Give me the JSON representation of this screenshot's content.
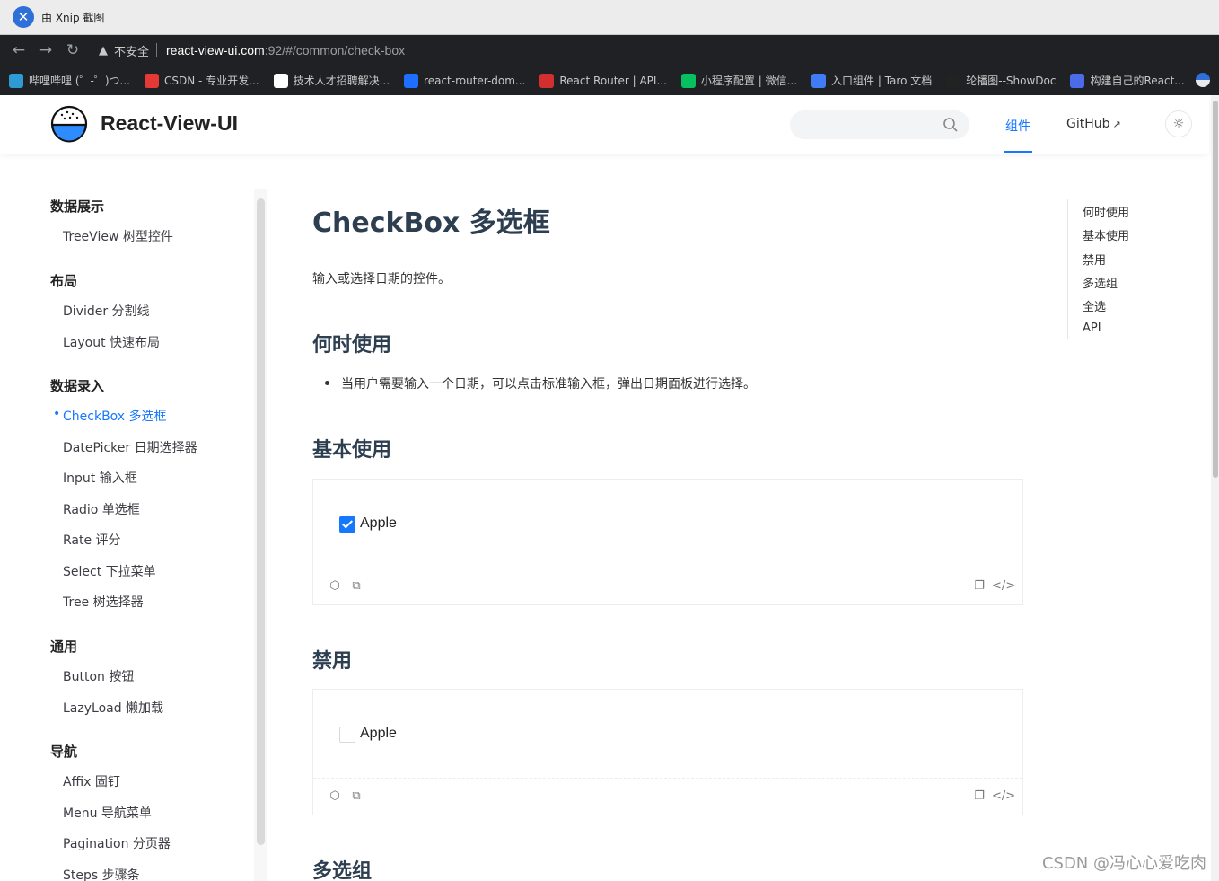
{
  "os_title": "由 Xnip 截图",
  "browser": {
    "insecure_label": "不安全",
    "url_host": "react-view-ui.com",
    "url_path": ":92/#/common/check-box",
    "bookmarks": [
      {
        "label": "哔哩哔哩 (゜-゜)つ...",
        "color": "#2f9bd6",
        "icon": "tv-icon"
      },
      {
        "label": "CSDN - 专业开发...",
        "color": "#e53935",
        "icon": "csdn-icon"
      },
      {
        "label": "技术人才招聘解决...",
        "color": "#ffffff",
        "icon": "recruit-icon"
      },
      {
        "label": "react-router-dom...",
        "color": "#1e6fff",
        "icon": "zhihu-icon"
      },
      {
        "label": "React Router | API...",
        "color": "#d32f2f",
        "icon": "react-router-icon"
      },
      {
        "label": "小程序配置 | 微信...",
        "color": "#07c160",
        "icon": "wechat-icon"
      },
      {
        "label": "入口组件 | Taro 文档",
        "color": "#3f7cf6",
        "icon": "taro-icon"
      },
      {
        "label": "轮播图--ShowDoc",
        "color": "#222222",
        "icon": "showdoc-icon"
      },
      {
        "label": "构建自己的React...",
        "color": "#4b6be8",
        "icon": "stack-icon"
      }
    ]
  },
  "header": {
    "site_title": "React-View-UI",
    "nav_components": "组件",
    "nav_github": "GitHub",
    "accent": "#1677ff"
  },
  "sidebar": {
    "groups": [
      {
        "title": "数据展示",
        "items": [
          "TreeView 树型控件"
        ]
      },
      {
        "title": "布局",
        "items": [
          "Divider 分割线",
          "Layout 快速布局"
        ]
      },
      {
        "title": "数据录入",
        "items": [
          "CheckBox 多选框",
          "DatePicker 日期选择器",
          "Input 输入框",
          "Radio 单选框",
          "Rate 评分",
          "Select 下拉菜单",
          "Tree 树选择器"
        ]
      },
      {
        "title": "通用",
        "items": [
          "Button 按钮",
          "LazyLoad 懒加载"
        ]
      },
      {
        "title": "导航",
        "items": [
          "Affix 固钉",
          "Menu 导航菜单",
          "Pagination 分页器",
          "Steps 步骤条"
        ]
      }
    ],
    "active_item": "CheckBox 多选框"
  },
  "content": {
    "title": "CheckBox 多选框",
    "description": "输入或选择日期的控件。",
    "sections": {
      "when": {
        "heading": "何时使用",
        "bullet": "当用户需要输入一个日期，可以点击标准输入框，弹出日期面板进行选择。"
      },
      "basic": {
        "heading": "基本使用",
        "checkbox_label": "Apple",
        "checked": true
      },
      "disabled": {
        "heading": "禁用",
        "checkbox_label": "Apple",
        "checked": false
      },
      "group": {
        "heading": "多选组"
      }
    }
  },
  "toc": [
    "何时使用",
    "基本使用",
    "禁用",
    "多选组",
    "全选",
    "API"
  ],
  "watermark": "CSDN @冯心心爱吃肉"
}
